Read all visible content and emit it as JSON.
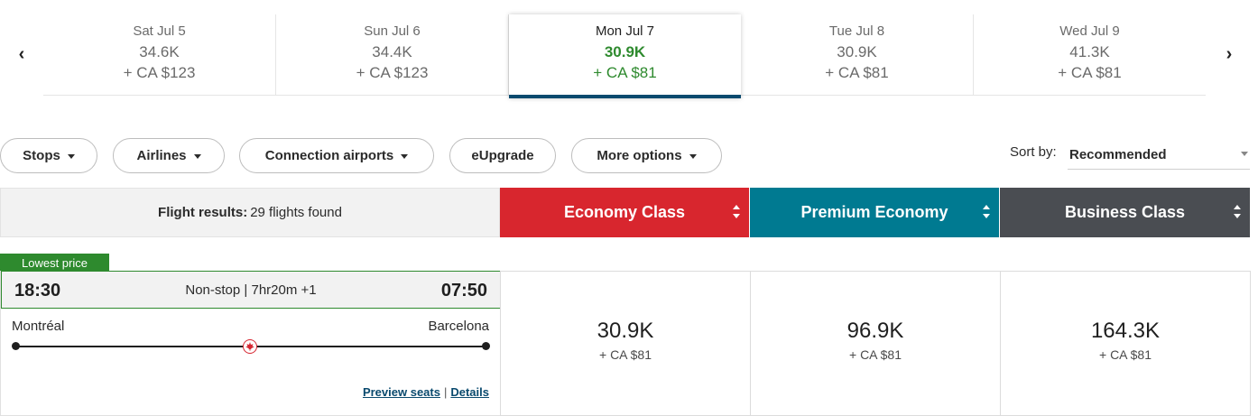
{
  "carousel": {
    "prev_icon": "chevron-left-icon",
    "next_icon": "chevron-right-icon",
    "dates": [
      {
        "label": "Sat Jul 5",
        "points": "34.6K",
        "cash": "+ CA $123",
        "selected": false
      },
      {
        "label": "Sun Jul 6",
        "points": "34.4K",
        "cash": "+ CA $123",
        "selected": false
      },
      {
        "label": "Mon Jul 7",
        "points": "30.9K",
        "cash": "+ CA $81",
        "selected": true
      },
      {
        "label": "Tue Jul 8",
        "points": "30.9K",
        "cash": "+ CA $81",
        "selected": false
      },
      {
        "label": "Wed Jul 9",
        "points": "41.3K",
        "cash": "+ CA $81",
        "selected": false
      }
    ]
  },
  "filters": {
    "stops": "Stops",
    "airlines": "Airlines",
    "connection_airports": "Connection airports",
    "eupgrade": "eUpgrade",
    "more_options": "More options"
  },
  "sort": {
    "label": "Sort by:",
    "value": "Recommended"
  },
  "results": {
    "label": "Flight results:",
    "count_text": "29 flights found"
  },
  "cabins": [
    {
      "name": "Economy Class",
      "color": "#d8262e"
    },
    {
      "name": "Premium Economy",
      "color": "#007a91"
    },
    {
      "name": "Business Class",
      "color": "#4a4d52"
    }
  ],
  "flight": {
    "badge": "Lowest price",
    "departure_time": "18:30",
    "arrival_time": "07:50",
    "duration": "Non-stop | 7hr20m +1",
    "origin": "Montréal",
    "destination": "Barcelona",
    "preview_seats": "Preview seats",
    "details": "Details",
    "separator": "|",
    "fares": [
      {
        "points": "30.9K",
        "cash": "+ CA $81"
      },
      {
        "points": "96.9K",
        "cash": "+ CA $81"
      },
      {
        "points": "164.3K",
        "cash": "+ CA $81"
      }
    ]
  },
  "colors": {
    "selected_green": "#2e8a2e",
    "selected_underline": "#0a4a6e",
    "link": "#0a4a6e"
  }
}
